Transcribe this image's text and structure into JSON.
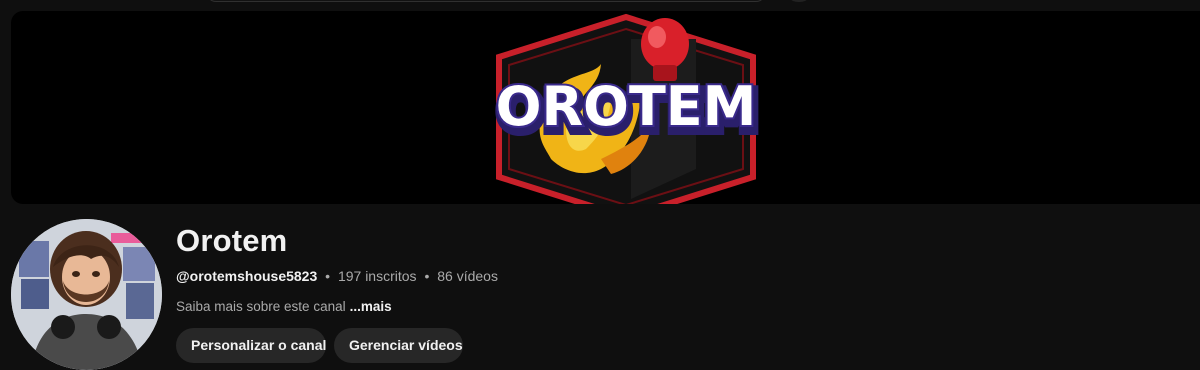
{
  "banner": {
    "logo_text": "OROTEM"
  },
  "channel": {
    "name": "Orotem",
    "handle": "@orotemshouse5823",
    "separator": "•",
    "subscribers": "197 inscritos",
    "videos": "86 vídeos",
    "about_text": "Saiba mais sobre este canal",
    "about_more": "...mais"
  },
  "actions": {
    "customize_label": "Personalizar o canal",
    "manage_label": "Gerenciar vídeos"
  },
  "colors": {
    "background": "#0f0f0f",
    "banner": "#000000",
    "button": "#272727",
    "logo_red": "#c8202a",
    "logo_purple": "#3a2a8c",
    "glove_red": "#d9202a"
  }
}
